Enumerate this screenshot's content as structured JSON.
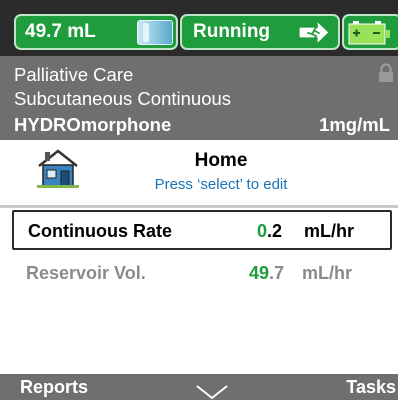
{
  "status": {
    "volume": "49.7 mL",
    "pump_state": "Running",
    "icons": [
      "reservoir-icon",
      "exit-run-icon",
      "battery-icon"
    ],
    "accent_color": "#1f9c3c"
  },
  "therapy": {
    "care_area": "Palliative Care",
    "route": "Subcutaneous Continuous",
    "drug": "HYDROmorphone",
    "concentration": "1mg/mL",
    "icon": "lock-icon"
  },
  "home": {
    "title": "Home",
    "hint": "Press ‘select’ to edit",
    "icon": "house-icon"
  },
  "rows": {
    "continuous_rate": {
      "label": "Continuous Rate",
      "value_int": "0",
      "value_dec": ".2",
      "unit": "mL/hr"
    },
    "reservoir_vol": {
      "label": "Reservoir Vol.",
      "value_int": "49",
      "value_dec": ".7",
      "unit": "mL/hr"
    }
  },
  "softkeys": {
    "left": "Reports",
    "right": "Tasks",
    "center_icon": "chevron-down-icon"
  }
}
